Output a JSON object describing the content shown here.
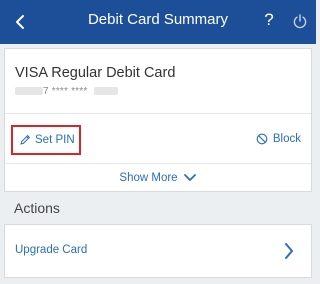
{
  "header": {
    "title": "Debit Card Summary",
    "help_label": "?",
    "back_icon": "back-arrow-icon",
    "power_icon": "power-icon"
  },
  "card": {
    "name": "VISA Regular Debit Card",
    "number_masked": "7 **** ****"
  },
  "card_actions": {
    "set_pin_label": "Set PIN",
    "block_label": "Block",
    "show_more_label": "Show More"
  },
  "actions": {
    "title": "Actions",
    "items": [
      {
        "label": "Upgrade Card"
      }
    ]
  },
  "colors": {
    "header_bg": "#1d4f99",
    "link": "#2a6ebb",
    "highlight_border": "#d3272c",
    "page_bg": "#eceff2"
  }
}
